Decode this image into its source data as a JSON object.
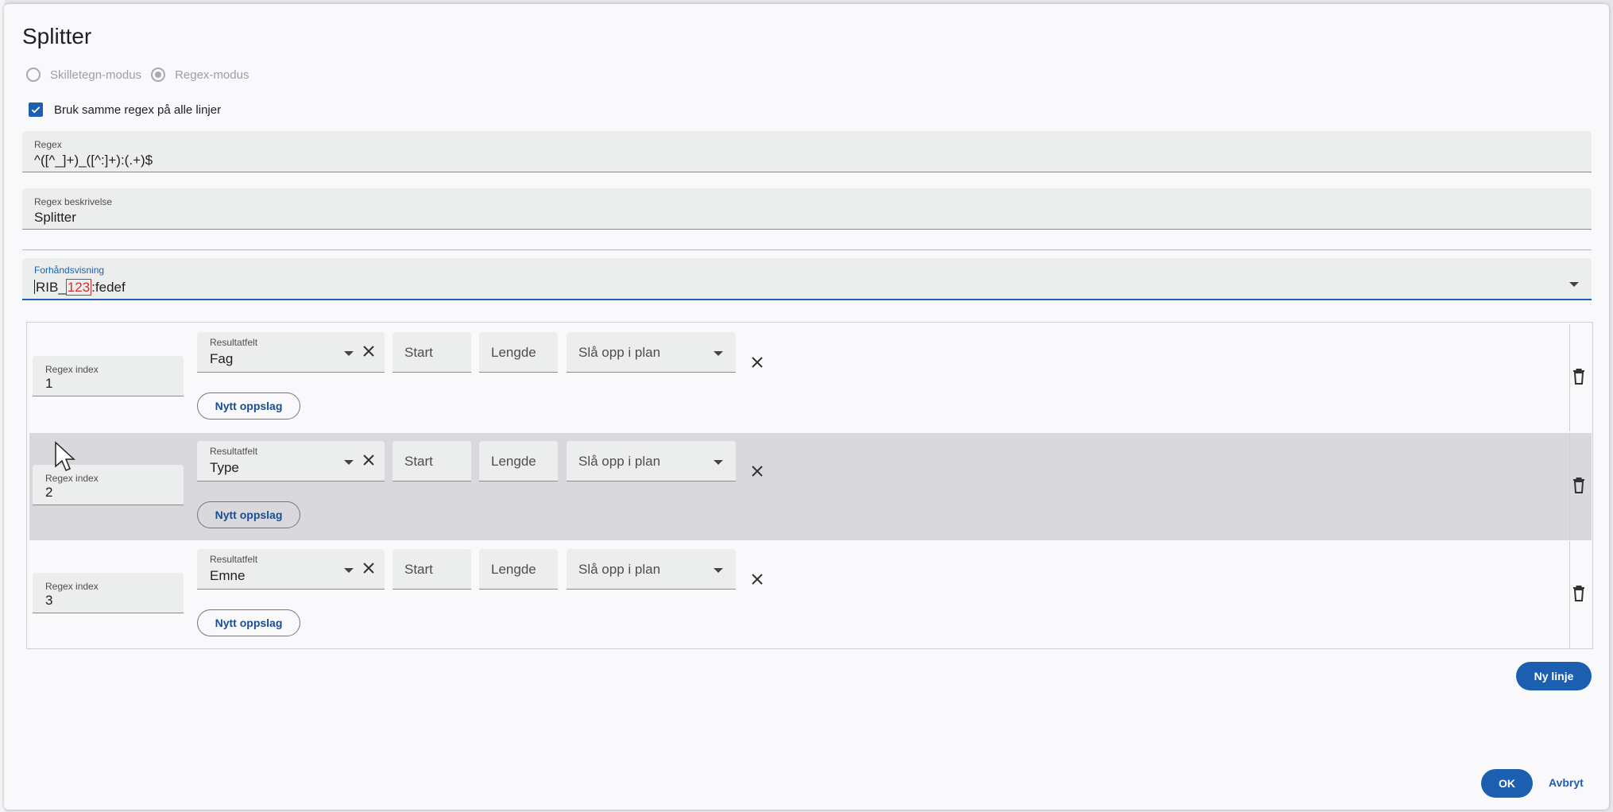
{
  "dialog": {
    "title": "Splitter",
    "modes": [
      {
        "label": "Skilletegn-modus",
        "selected": false
      },
      {
        "label": "Regex-modus",
        "selected": true
      }
    ],
    "same_regex_checkbox": {
      "label": "Bruk samme regex på alle linjer",
      "checked": true
    },
    "regex_field": {
      "label": "Regex",
      "value": "^([^_]+)_([^:]+):(.+)$"
    },
    "regex_description_field": {
      "label": "Regex beskrivelse",
      "value": "Splitter"
    },
    "preview_field": {
      "label": "Forhåndsvisning",
      "value_prefix": "RIB_",
      "value_highlight": "123",
      "value_suffix": ":fedef"
    },
    "rows": [
      {
        "regex_index_label": "Regex index",
        "regex_index_value": "1",
        "result_field_label": "Resultatfelt",
        "result_field_value": "Fag",
        "start_placeholder": "Start",
        "length_placeholder": "Lengde",
        "lookup_placeholder": "Slå opp i plan",
        "new_lookup_label": "Nytt oppslag"
      },
      {
        "regex_index_label": "Regex index",
        "regex_index_value": "2",
        "result_field_label": "Resultatfelt",
        "result_field_value": "Type",
        "start_placeholder": "Start",
        "length_placeholder": "Lengde",
        "lookup_placeholder": "Slå opp i plan",
        "new_lookup_label": "Nytt oppslag"
      },
      {
        "regex_index_label": "Regex index",
        "regex_index_value": "3",
        "result_field_label": "Resultatfelt",
        "result_field_value": "Emne",
        "start_placeholder": "Start",
        "length_placeholder": "Lengde",
        "lookup_placeholder": "Slå opp i plan",
        "new_lookup_label": "Nytt oppslag"
      }
    ],
    "new_line_button": "Ny linje",
    "ok_button": "OK",
    "cancel_button": "Avbryt"
  },
  "colors": {
    "accent": "#1c5fb0",
    "highlight": "#d32f2f",
    "row_hover": "#d9d9dd",
    "field_bg": "#eceeed"
  },
  "icons": [
    "checkmark-icon",
    "dropdown-arrow-icon",
    "close-icon",
    "delete-icon",
    "mouse-cursor-icon"
  ]
}
